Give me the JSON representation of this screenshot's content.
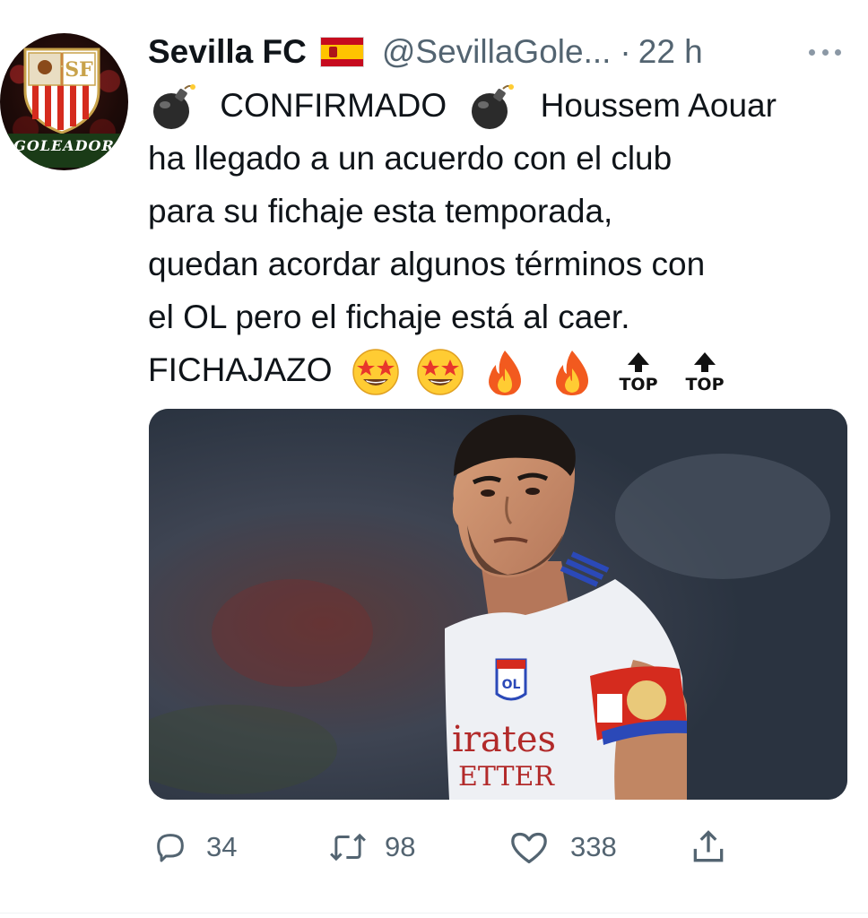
{
  "avatar": {
    "ribbon_text": "GOLEADOR",
    "crest_letters": "SF"
  },
  "header": {
    "display_name": "Sevilla FC",
    "handle": "@SevillaGole...",
    "separator": "·",
    "time": "22 h",
    "flag_icon": "spain-flag-icon",
    "more_icon": "more-options-icon"
  },
  "tweet": {
    "line1_a": "CONFIRMADO",
    "line1_b": "Houssem Aouar",
    "line2": "ha llegado a un acuerdo con el club",
    "line3": "para su fichaje esta temporada,",
    "line4": "quedan acordar algunos términos con",
    "line5": "el OL pero el fichaje está al caer.",
    "line6": "FICHAJAZO",
    "top_emoji_text": "TOP",
    "emojis": [
      "bomb-emoji",
      "bomb-emoji",
      "star-struck-emoji",
      "star-struck-emoji",
      "fire-emoji",
      "fire-emoji",
      "top-arrow-emoji",
      "top-arrow-emoji"
    ]
  },
  "media": {
    "jersey_text_1": "irates",
    "jersey_text_2": "ETTER",
    "badge_text": "OL"
  },
  "actions": {
    "replies": "34",
    "retweets": "98",
    "likes": "338",
    "reply_icon": "reply-icon",
    "retweet_icon": "retweet-icon",
    "like_icon": "heart-icon",
    "share_icon": "share-icon"
  },
  "colors": {
    "text": "#0f1419",
    "secondary": "#536471",
    "sevilla_red": "#d52b1e",
    "flag_red": "#c60b1e",
    "flag_yellow": "#ffc400"
  }
}
